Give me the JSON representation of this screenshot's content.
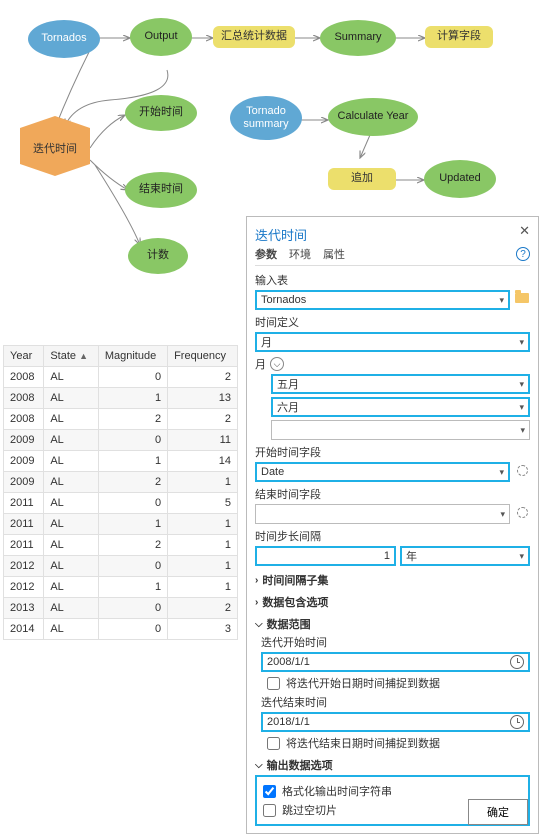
{
  "diagram": {
    "nodes": {
      "tornados": "Tornados",
      "output": "Output",
      "iterate": "迭代时间",
      "start": "开始时间",
      "end": "结束时间",
      "count": "计数",
      "agg": "汇总统计数据",
      "summary": "Summary",
      "calcfield": "计算字段",
      "tsummary": "Tornado summary",
      "calcyear": "Calculate Year",
      "append": "追加",
      "updated": "Updated"
    }
  },
  "table": {
    "headers": [
      "Year",
      "State",
      "Magnitude",
      "Frequency"
    ],
    "rows": [
      [
        "2008",
        "AL",
        "0",
        "2"
      ],
      [
        "2008",
        "AL",
        "1",
        "13"
      ],
      [
        "2008",
        "AL",
        "2",
        "2"
      ],
      [
        "2009",
        "AL",
        "0",
        "11"
      ],
      [
        "2009",
        "AL",
        "1",
        "14"
      ],
      [
        "2009",
        "AL",
        "2",
        "1"
      ],
      [
        "2011",
        "AL",
        "0",
        "5"
      ],
      [
        "2011",
        "AL",
        "1",
        "1"
      ],
      [
        "2011",
        "AL",
        "2",
        "1"
      ],
      [
        "2012",
        "AL",
        "0",
        "1"
      ],
      [
        "2012",
        "AL",
        "1",
        "1"
      ],
      [
        "2013",
        "AL",
        "0",
        "2"
      ],
      [
        "2014",
        "AL",
        "0",
        "3"
      ]
    ]
  },
  "panel": {
    "title": "迭代时间",
    "tabs": [
      "参数",
      "环境",
      "属性"
    ],
    "input_table_lbl": "输入表",
    "input_table": "Tornados",
    "time_def_lbl": "时间定义",
    "time_def": "月",
    "month_lbl": "月",
    "months": [
      "五月",
      "六月"
    ],
    "start_field_lbl": "开始时间字段",
    "start_field": "Date",
    "end_field_lbl": "结束时间字段",
    "step_lbl": "时间步长间隔",
    "step_val": "1",
    "step_unit": "年",
    "sec_subset": "时间间隔子集",
    "sec_include": "数据包含选项",
    "sec_range": "数据范围",
    "iter_start_lbl": "迭代开始时间",
    "iter_start": "2008/1/1",
    "snap_start": "将迭代开始日期时间捕捉到数据",
    "iter_end_lbl": "迭代结束时间",
    "iter_end": "2018/1/1",
    "snap_end": "将迭代结束日期时间捕捉到数据",
    "sec_output": "输出数据选项",
    "fmt_str": "格式化输出时间字符串",
    "skip_empty": "跳过空切片",
    "ok": "确定"
  }
}
